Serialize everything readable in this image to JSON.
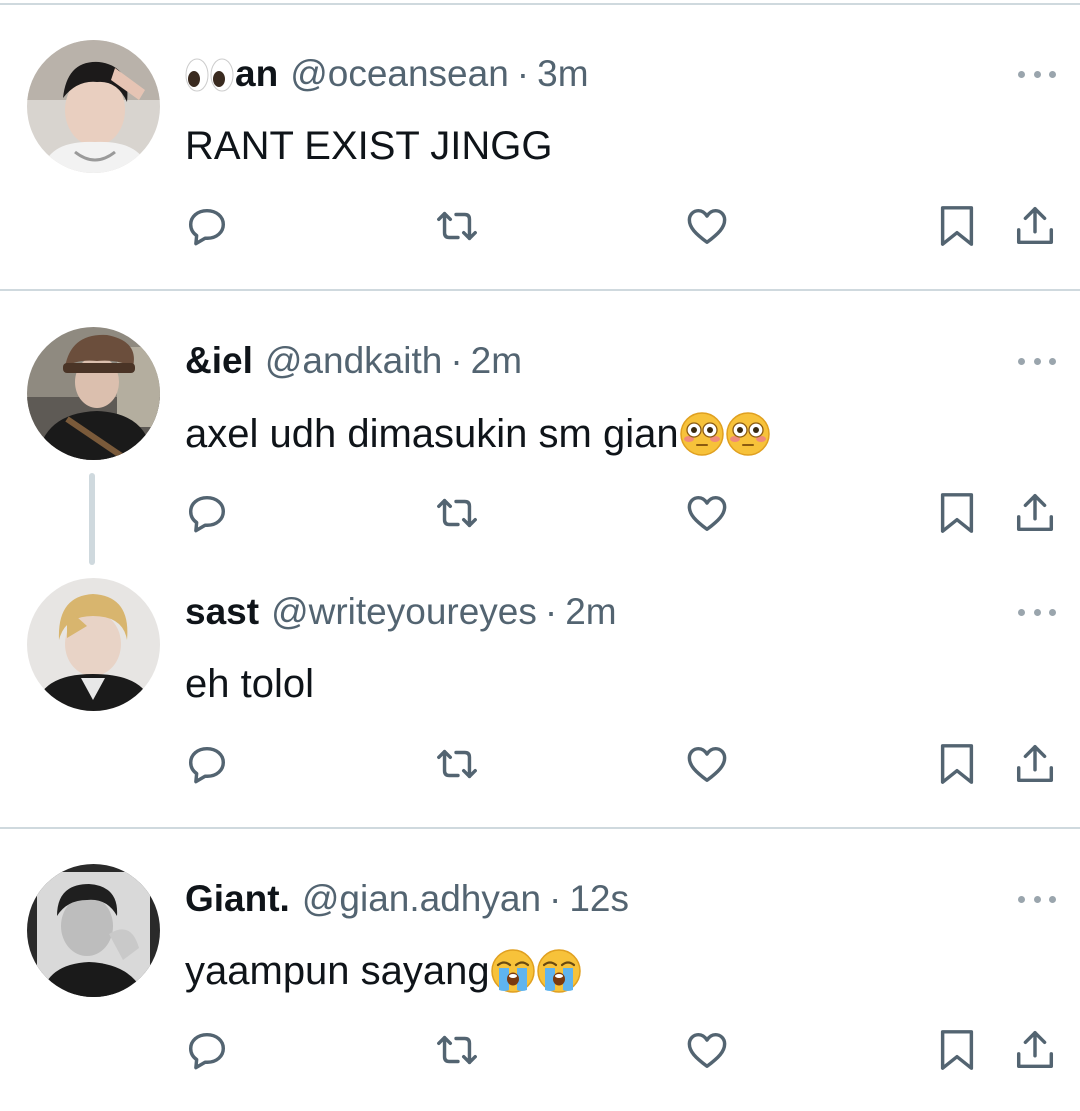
{
  "tweets": [
    {
      "name_emoji": "eyes-emoji",
      "name": "an",
      "handle": "@oceansean",
      "separator": "·",
      "time": "3m",
      "text": "RANT EXIST JINGG",
      "text_emojis": []
    },
    {
      "name": "&iel",
      "handle": "@andkaith",
      "separator": "·",
      "time": "2m",
      "text": "axel udh dimasukin sm gian",
      "text_emojis": [
        "flushed-face-emoji",
        "flushed-face-emoji"
      ]
    },
    {
      "name": "sast",
      "handle": "@writeyoureyes",
      "separator": "·",
      "time": "2m",
      "text": "eh tolol",
      "text_emojis": []
    },
    {
      "name": "Giant.",
      "handle": "@gian.adhyan",
      "separator": "·",
      "time": "12s",
      "text": "yaampun sayang",
      "text_emojis": [
        "loudly-crying-face-emoji",
        "loudly-crying-face-emoji"
      ]
    }
  ],
  "icons": {
    "reply": "reply-icon",
    "retweet": "retweet-icon",
    "like": "heart-icon",
    "bookmark": "bookmark-icon",
    "share": "share-icon",
    "more": "more-icon"
  },
  "colors": {
    "text": "#0f1419",
    "secondary": "#536471",
    "divider": "#cfd9de",
    "icon": "#536471"
  }
}
